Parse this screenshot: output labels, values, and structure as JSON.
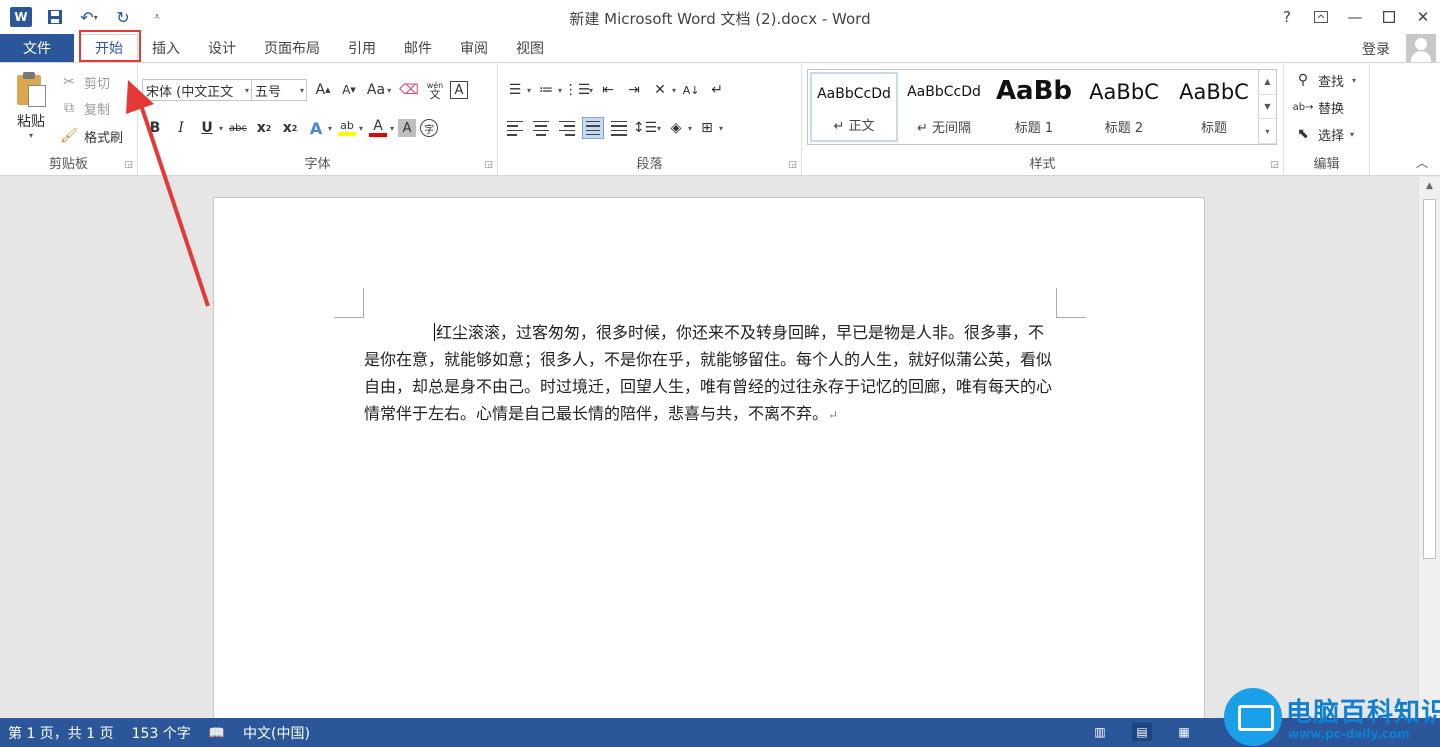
{
  "window": {
    "title": "新建 Microsoft Word 文档 (2).docx - Word",
    "help": "?",
    "qat_more": "⩡"
  },
  "tabs": {
    "file": "文件",
    "items": [
      "开始",
      "插入",
      "设计",
      "页面布局",
      "引用",
      "邮件",
      "审阅",
      "视图"
    ],
    "login": "登录"
  },
  "clipboard": {
    "paste": "粘贴",
    "cut": "剪切",
    "copy": "复制",
    "format_painter": "格式刷",
    "label": "剪贴板"
  },
  "font": {
    "name": "宋体 (中文正文",
    "size": "五号",
    "case": "Aa",
    "phonetic": "wén",
    "label": "字体"
  },
  "paragraph": {
    "label": "段落"
  },
  "styles": {
    "label": "样式",
    "items": [
      {
        "sample": "AaBbCcDd",
        "name": "↵ 正文"
      },
      {
        "sample": "AaBbCcDd",
        "name": "↵ 无间隔"
      },
      {
        "sample": "AaBb",
        "name": "标题 1"
      },
      {
        "sample": "AaBbC",
        "name": "标题 2"
      },
      {
        "sample": "AaBbC",
        "name": "标题"
      }
    ]
  },
  "editing": {
    "find": "查找",
    "replace": "替换",
    "select": "选择",
    "label": "编辑"
  },
  "document": {
    "body": "红尘滚滚，过客匆匆，很多时候，你还来不及转身回眸，早已是物是人非。很多事，不是你在意，就能够如意；很多人，不是你在乎，就能够留住。每个人的人生，就好似蒲公英，看似自由，却总是身不由己。时过境迁，回望人生，唯有曾经的过往永存于记忆的回廊，唯有每天的心情常伴于左右。心情是自己最长情的陪伴，悲喜与共，不离不弃。",
    "para_mark": "↵"
  },
  "status": {
    "page": "第 1 页，共 1 页",
    "words": "153 个字",
    "language": "中文(中国)"
  },
  "watermark": {
    "title": "电脑百科知识",
    "url": "www.pc-daily.com"
  },
  "colors": {
    "accent": "#2b579a",
    "highlight": "#e53935"
  }
}
